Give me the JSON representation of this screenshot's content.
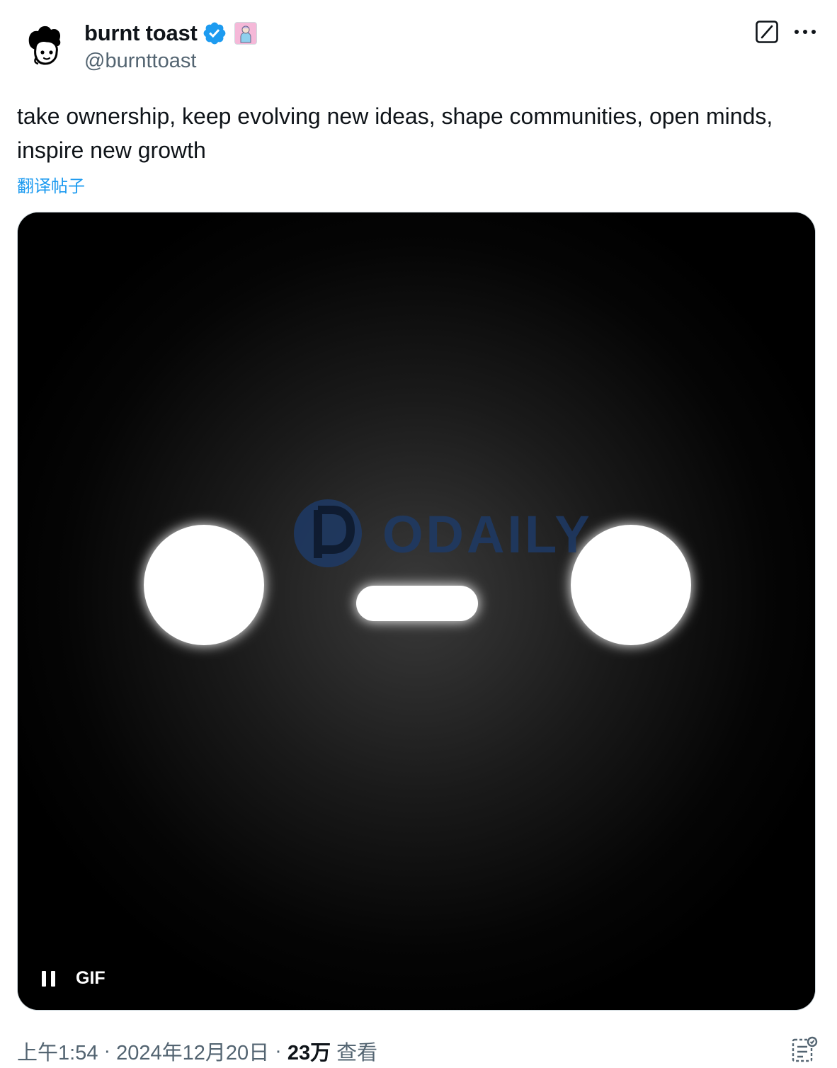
{
  "author": {
    "display_name": "burnt toast",
    "handle": "@burnttoast",
    "verified": true,
    "avatar_icon": "burnt-toast-avatar",
    "affiliate_badge_icon": "affiliate-badge-icon"
  },
  "header_actions": {
    "grok_icon": "grok-icon",
    "more_icon": "more-options-icon"
  },
  "tweet": {
    "text": "take ownership, keep evolving new ideas, shape communities, open minds, inspire new growth",
    "translate_label": "翻译帖子"
  },
  "media": {
    "type_label": "GIF",
    "watermark_text": "ODAILY",
    "pause_icon": "pause-icon"
  },
  "meta": {
    "time": "上午1:54",
    "separator": "·",
    "date": "2024年12月20日",
    "views_count": "23万",
    "views_label": "查看",
    "analytics_icon": "analytics-icon"
  },
  "colors": {
    "link_blue": "#1d9bf0",
    "verified_blue": "#1d9bf0",
    "secondary_text": "#536471",
    "primary_text": "#0f1419",
    "watermark": "#1e3a66"
  }
}
